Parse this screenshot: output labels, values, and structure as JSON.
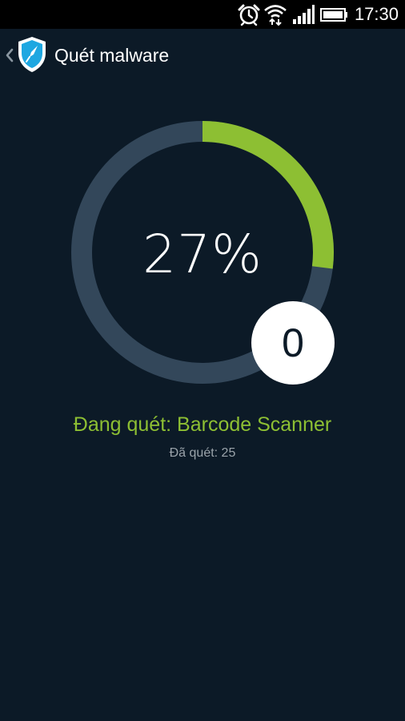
{
  "status_bar": {
    "time": "17:30",
    "icons": [
      "alarm-icon",
      "wifi-icon",
      "signal-icon",
      "battery-icon"
    ]
  },
  "app_bar": {
    "title": "Quét malware",
    "back_icon": "chevron-left-icon",
    "logo_icon": "shield-logo-icon"
  },
  "scan": {
    "percent_label": "27%",
    "progress": 0.27,
    "threats_found": "0",
    "scanning_label": "Đang quét: Barcode Scanner",
    "scanned_label": "Đã quét: 25"
  },
  "colors": {
    "background": "#0c1a27",
    "ring_track": "#33475a",
    "ring_progress": "#8dbf33",
    "accent_green": "#8dbf33",
    "logo_blue": "#1ea7e1",
    "muted_text": "#9aa3aa"
  }
}
